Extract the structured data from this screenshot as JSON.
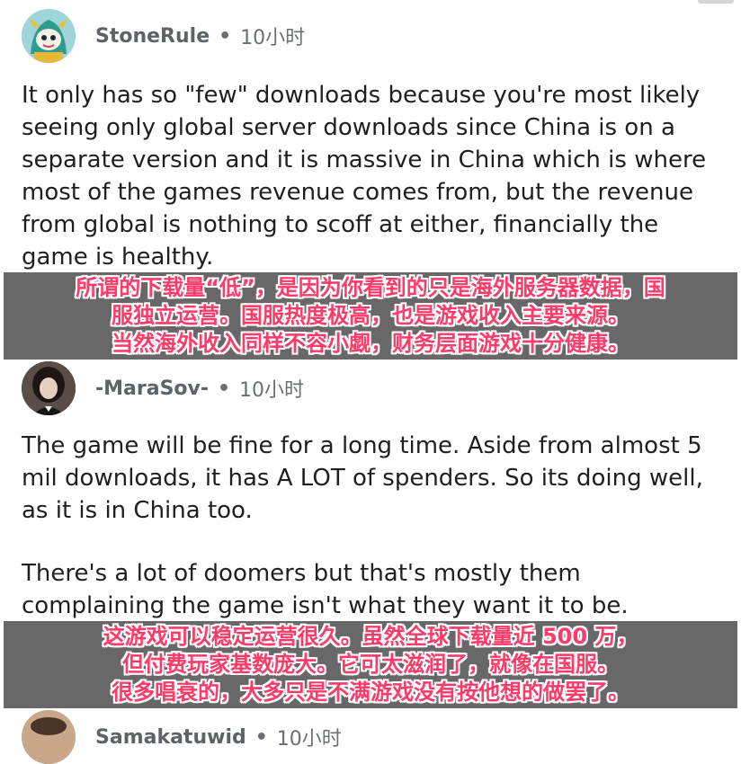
{
  "comments": [
    {
      "username": "StoneRule",
      "time": "10小时",
      "paragraphs": [
        "It only has so \"few\" downloads because you're most likely\nseeing only global server downloads since China is on a\nseparate version and it is massive in China which is where\nmost of the games revenue comes from, but the revenue\nfrom global is nothing to scoff at either, financially the\ngame is healthy."
      ],
      "translation": [
        "所谓的下载量“低”，是因为你看到的只是海外服务器数据，国",
        "服独立运营。国服热度极高，也是游戏收入主要来源。",
        "当然海外收入同样不容小觑，财务层面游戏十分健康。"
      ]
    },
    {
      "username": "-MaraSov-",
      "time": "10小时",
      "paragraphs": [
        "The game will be fine for a long time. Aside from almost 5\nmil downloads, it has A LOT of spenders. So its doing well,\nas it is in China too.",
        "There's a lot of doomers but that's mostly them\ncomplaining the game isn't what they want it to be."
      ],
      "translation": [
        "这游戏可以稳定运营很久。虽然全球下载量近 500 万，",
        "但付费玩家基数庞大。它可太滋润了，就像在国服。",
        "很多唱衰的，大多只是不满游戏没有按他想的做罢了。"
      ]
    },
    {
      "username": "Samakatuwid",
      "time": "10小时"
    }
  ],
  "separator": "•",
  "colors": {
    "overlay_bg": "#5c5c5c",
    "overlay_text": "#ff3b69",
    "meta_text": "#6b6f73"
  }
}
